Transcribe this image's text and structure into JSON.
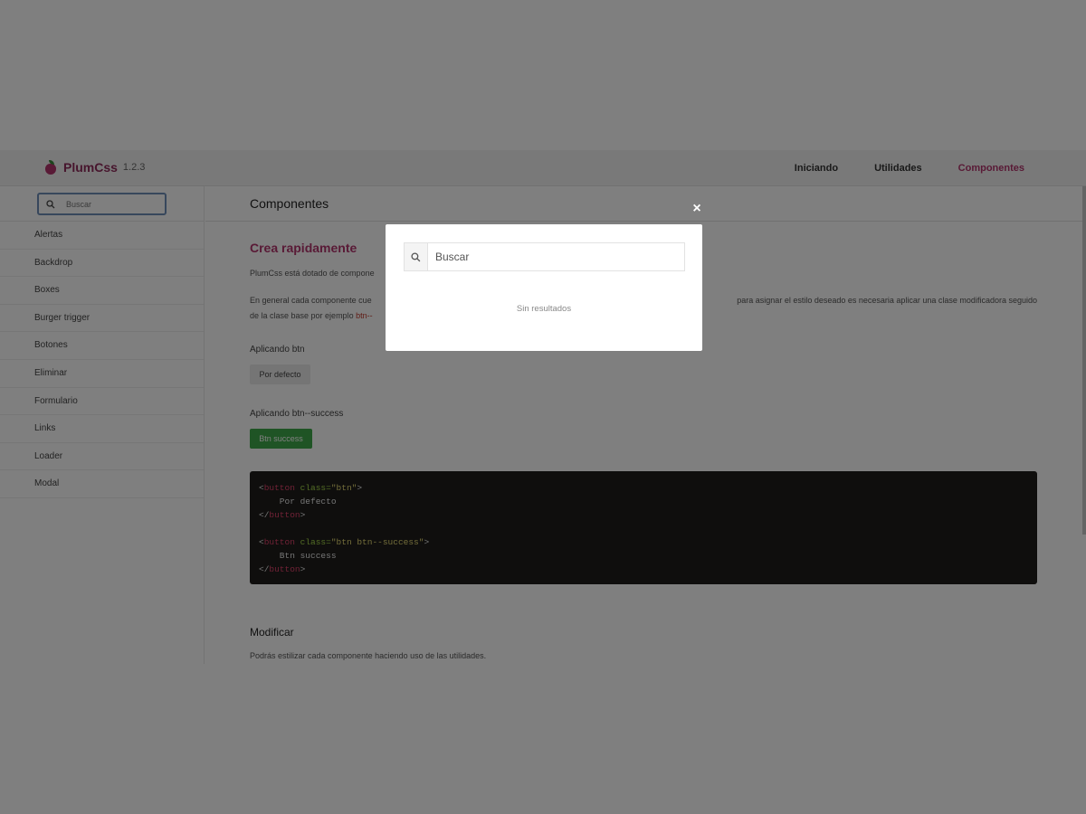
{
  "header": {
    "brand_name": "PlumCss",
    "version": "1.2.3",
    "nav": [
      {
        "label": "Iniciando",
        "active": false
      },
      {
        "label": "Utilidades",
        "active": false
      },
      {
        "label": "Componentes",
        "active": true
      }
    ]
  },
  "sidebar": {
    "search_placeholder": "Buscar",
    "items": [
      {
        "label": "Alertas"
      },
      {
        "label": "Backdrop"
      },
      {
        "label": "Boxes"
      },
      {
        "label": "Burger trigger"
      },
      {
        "label": "Botones"
      },
      {
        "label": "Eliminar"
      },
      {
        "label": "Formulario"
      },
      {
        "label": "Links"
      },
      {
        "label": "Loader"
      },
      {
        "label": "Modal"
      }
    ]
  },
  "content": {
    "page_title": "Componentes",
    "section_title": "Crea rapidamente",
    "intro": "PlumCss está dotado de compone",
    "para_left": "En general cada componente cue",
    "para_right": "para asignar el estilo deseado es necesaria aplicar una clase modificadora seguido",
    "para_line2_prefix": "de la clase base por ejemplo ",
    "para_line2_code": "btn--",
    "example1_label": "Aplicando btn",
    "example1_button": "Por defecto",
    "example2_label": "Aplicando btn--success",
    "example2_button": "Btn success",
    "code": {
      "l1_open": "<",
      "l1_tag": "button",
      "l1_attr": " class=",
      "l1_str": "\"btn\"",
      "l1_close": ">",
      "l2_text": "    Por defecto",
      "l3_open": "</",
      "l3_tag": "button",
      "l3_close": ">",
      "l5_open": "<",
      "l5_tag": "button",
      "l5_attr": " class=",
      "l5_str": "\"btn btn--success\"",
      "l5_close": ">",
      "l6_text": "    Btn success",
      "l7_open": "</",
      "l7_tag": "button",
      "l7_close": ">"
    },
    "subheading": "Modificar",
    "subtext": "Podrás estilizar cada componente haciendo uso de las utilidades."
  },
  "modal": {
    "close_glyph": "×",
    "search_placeholder": "Buscar",
    "search_value": "",
    "empty_message": "Sin resultados",
    "search_icon": "search-icon",
    "close_icon": "close-icon"
  },
  "colors": {
    "brand": "#b2346d",
    "success": "#3fa84a",
    "overlay": "rgba(0,0,0,0.5)",
    "code_bg": "#1e1d1b"
  }
}
